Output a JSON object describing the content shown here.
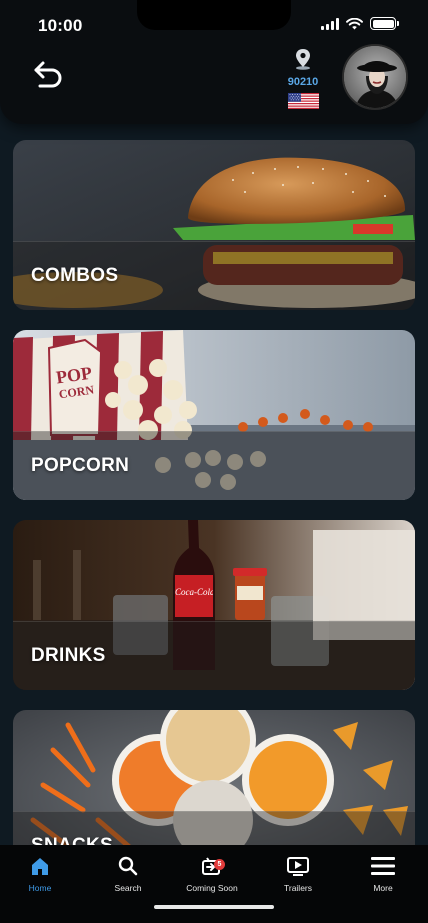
{
  "status_bar": {
    "time": "10:00"
  },
  "header": {
    "location": {
      "zip": "90210",
      "icon": "location-pin-icon"
    },
    "flag": "us-flag-icon",
    "avatar": "user-avatar"
  },
  "categories": [
    {
      "label": "COMBOS"
    },
    {
      "label": "POPCORN",
      "bag_text": [
        "POP",
        "CORN"
      ]
    },
    {
      "label": "DRINKS",
      "bottle_label": "Coca-Cola"
    },
    {
      "label": "SNACKS"
    }
  ],
  "tabbar": {
    "items": [
      {
        "label": "Home",
        "icon": "home-icon",
        "active": true
      },
      {
        "label": "Search",
        "icon": "search-icon"
      },
      {
        "label": "Coming Soon",
        "icon": "coming-soon-icon",
        "badge": "5"
      },
      {
        "label": "Trailers",
        "icon": "trailers-icon"
      },
      {
        "label": "More",
        "icon": "menu-icon"
      }
    ]
  },
  "colors": {
    "accent": "#3f9be8",
    "zip": "#5aa7e6",
    "background": "#0f1a22",
    "badge": "#e23b3b"
  }
}
